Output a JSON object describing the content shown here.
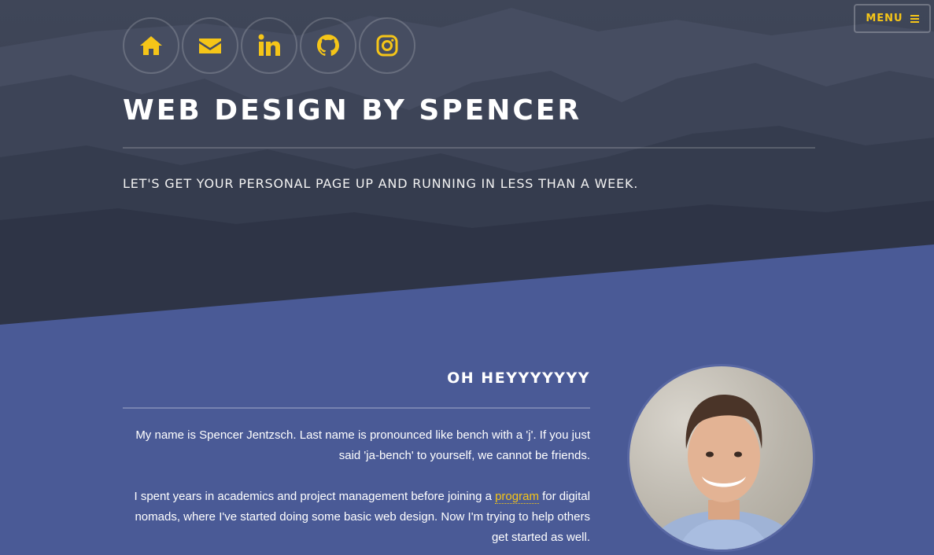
{
  "header": {
    "menu_label": "MENU",
    "accent_color": "#f5c518"
  },
  "socials": [
    {
      "icon": "home-icon"
    },
    {
      "icon": "envelope-icon"
    },
    {
      "icon": "linkedin-icon"
    },
    {
      "icon": "github-icon"
    },
    {
      "icon": "instagram-icon"
    }
  ],
  "hero": {
    "title": "WEB DESIGN BY SPENCER",
    "tagline": "LET'S GET YOUR PERSONAL PAGE UP AND RUNNING IN LESS THAN A WEEK."
  },
  "about": {
    "heading": "OH HEYYYYYYY",
    "p1": "My name is Spencer Jentzsch. Last name is pronounced like bench with a 'j'. If you just said 'ja-bench' to yourself, we cannot be friends.",
    "p2_before": "I spent years in academics and project management before joining a ",
    "p2_link": "program",
    "p2_after": " for digital nomads, where I've started doing some basic web design. Now I'm trying to help others get started as well."
  },
  "colors": {
    "hero_bg": "#3a4052",
    "section_bg": "#4a5a96",
    "accent": "#f5c518"
  }
}
